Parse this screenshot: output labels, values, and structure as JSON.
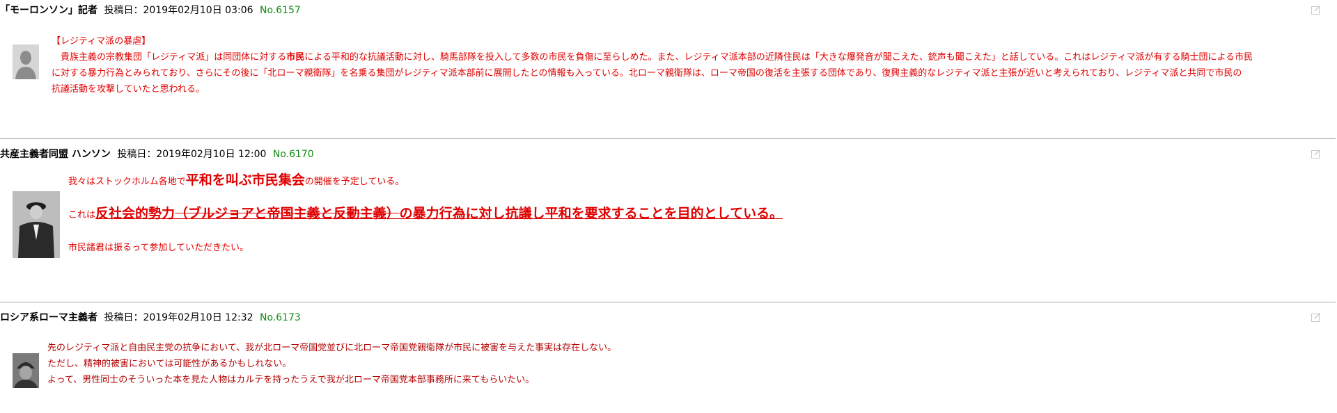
{
  "posts": [
    {
      "author": "「モーロンソン」記者",
      "date_label": "投稿日：",
      "date": "2019年02月10日 03:06",
      "number": "No.6157",
      "title": "【レジティマ派の暴虐】",
      "line1_a": "　貴族主義の宗教集団「レジティマ派」は同団体に対する",
      "line1_b": "市民",
      "line1_c": "による平和的な抗議活動に対し、騎馬部隊を投入して多数の市民を負傷に至らしめた。また、レジティマ派本部の近隣住民は「大きな爆発音が聞こえた、銃声も聞こえた」と話している。これはレジティマ派が有する騎士団による市民",
      "line2": "に対する暴力行為とみられており、さらにその後に「北ローマ親衛隊」を名乗る集団がレジティマ派本部前に展開したとの情報も入っている。北ローマ親衛隊は、ローマ帝国の復活を主張する団体であり、復興主義的なレジティマ派と主張が近いと考えられており、レジティマ派と共同で市民の",
      "line3": "抗議活動を攻撃していたと思われる。"
    },
    {
      "author": "共産主義者同盟 ハンソン",
      "date_label": "投稿日：",
      "date": "2019年02月10日 12:00",
      "number": "No.6170",
      "line1_a": "我々はストックホルム各地で",
      "line1_b": "平和を叫ぶ市民集会",
      "line1_c": "の開催を予定している。",
      "line2_a": "これは",
      "line2_b": "反社会的勢力",
      "line2_c": "（ブルジョアと帝国主義と反動主義）",
      "line2_d": "の暴力行為に対し抗議し平和を要求することを目的としている。",
      "line3": "市民諸君は振るって参加していただきたい。"
    },
    {
      "author": "ロシア系ローマ主義者",
      "date_label": "投稿日：",
      "date": "2019年02月10日 12:32",
      "number": "No.6173",
      "line1": "先のレジティマ派と自由民主党の抗争において、我が北ローマ帝国党並びに北ローマ帝国党親衛隊が市民に被害を与えた事実は存在しない。",
      "line2": "ただし、精神的被害においては可能性があるかもしれない。",
      "line3": "よって、男性同士のそういった本を見た人物はカルテを持ったうえで我が北ローマ帝国党本部事務所に来てもらいたい。"
    }
  ],
  "icons": {
    "edit": "edit-icon",
    "avatar": "user-avatar"
  },
  "colors": {
    "body_text": "#e00000",
    "post_number": "#128c12",
    "divider": "#a8a8a8"
  }
}
